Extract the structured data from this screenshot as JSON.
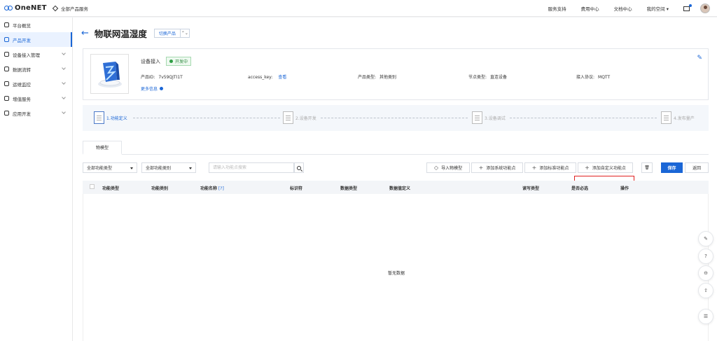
{
  "topbar": {
    "logo": "OneNET",
    "all_products": "全部产品服务",
    "nav": [
      "服务支持",
      "费用中心",
      "文档中心",
      "我的空间 ▾"
    ]
  },
  "sidebar": {
    "items": [
      {
        "label": "平台概览",
        "icon": "home-icon"
      },
      {
        "label": "产品开发",
        "icon": "cube-icon"
      },
      {
        "label": "设备接入管理",
        "icon": "device-icon"
      },
      {
        "label": "数据流转",
        "icon": "flow-icon"
      },
      {
        "label": "运维监控",
        "icon": "monitor-icon"
      },
      {
        "label": "增值服务",
        "icon": "service-icon"
      },
      {
        "label": "应用开发",
        "icon": "code-icon"
      }
    ]
  },
  "header": {
    "back": "←",
    "title": "物联网温湿度",
    "switch_label": "切换产品",
    "switch_icon": "⌃⌄"
  },
  "info": {
    "access_title": "设备接入",
    "status": "开发中",
    "product_id_label": "产品ID:",
    "product_id": "7v59QJTI1T",
    "access_key_label": "access_key:",
    "access_key_link": "查看",
    "category_label": "产品类型:",
    "category": "其他类别",
    "node_label": "节点类型:",
    "node": "直连设备",
    "protocol_label": "接入协议:",
    "protocol": "MQTT",
    "more": "更多信息"
  },
  "steps": [
    "1.功能定义",
    "2.设备开发",
    "3.设备调试",
    "4.发布量产"
  ],
  "tabs": [
    "物模型"
  ],
  "filters": {
    "type": "全部功能类型",
    "category": "全部功能类别",
    "search_placeholder": "请输入功能点搜索"
  },
  "buttons": {
    "import": "导入物模型",
    "add_system": "添加系统功能点",
    "add_standard": "添加标准功能点",
    "add_custom": "添加自定义功能点",
    "save": "保存",
    "back": "返回"
  },
  "table": {
    "headers": [
      "功能类型",
      "功能类别",
      "功能名称",
      "标识符",
      "数据类型",
      "数据值定义",
      "读写类型",
      "是否必选",
      "操作"
    ],
    "empty": "暂无数据"
  },
  "float_buttons": [
    "edit-icon",
    "help-icon",
    "minus-icon",
    "upload-icon",
    "menu-icon"
  ],
  "colors": {
    "accent": "#1a66d6",
    "status_green": "#2f9e44",
    "highlight_red": "#e02020"
  }
}
